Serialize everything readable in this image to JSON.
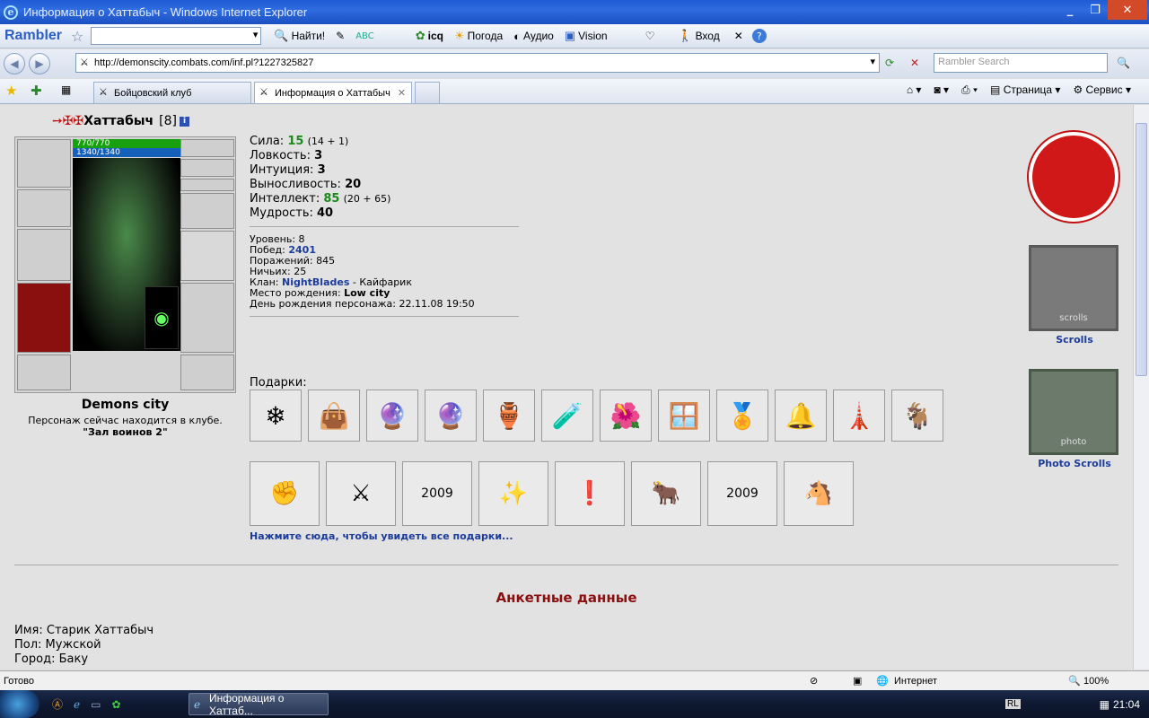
{
  "window": {
    "title": "Информация о Хаттабыч - Windows Internet Explorer",
    "controls": [
      "_",
      "❐",
      "✕"
    ]
  },
  "toolbar": {
    "brand": "Rambler",
    "find_label": "Найти!",
    "icq": "icq",
    "weather": "Погода",
    "audio": "Аудио",
    "vision": "Vision",
    "login": "Вход"
  },
  "address": {
    "url": "http://demonscity.combats.com/inf.pl?1227325827",
    "search_placeholder": "Rambler Search"
  },
  "tabs": [
    {
      "label": "Бойцовский клуб"
    },
    {
      "label": "Информация о Хаттабыч",
      "close": "✕"
    }
  ],
  "cmdbar": {
    "page": "Страница",
    "service": "Сервис"
  },
  "char": {
    "name": "Хаттабыч",
    "level": "[8]",
    "hp": "770/770",
    "mp": "1340/1340",
    "city": "Demons city",
    "location_text": "Персонаж сейчас находится в клубе.",
    "room": "\"Зал воинов 2\""
  },
  "stats": [
    {
      "label": "Сила:",
      "value": "15",
      "extra": "(14 + 1)",
      "green": true
    },
    {
      "label": "Ловкость:",
      "value": "3",
      "extra": "",
      "green": false
    },
    {
      "label": "Интуиция:",
      "value": "3",
      "extra": "",
      "green": false
    },
    {
      "label": "Выносливость:",
      "value": "20",
      "extra": "",
      "green": false
    },
    {
      "label": "Интеллект:",
      "value": "85",
      "extra": "(20 + 65)",
      "green": true
    },
    {
      "label": "Мудрость:",
      "value": "40",
      "extra": "",
      "green": false
    }
  ],
  "info": {
    "level_label": "Уровень:",
    "level": "8",
    "wins_label": "Побед:",
    "wins": "2401",
    "losses_label": "Поражений:",
    "losses": "845",
    "draws_label": "Ничьих:",
    "draws": "25",
    "clan_label": "Клан:",
    "clan": "NightBlades",
    "clan_rank": "- Кайфарик",
    "birthplace_label": "Место рождения:",
    "birthplace": "Low city",
    "birthday_label": "День рождения персонажа:",
    "birthday": "22.11.08 19:50"
  },
  "gifts": {
    "label": "Подарки:",
    "all_link": "Нажмите сюда, чтобы увидеть все подарки...",
    "items": [
      "❄",
      "👜",
      "🔮",
      "🔮",
      "🏺",
      "🧪",
      "🌺",
      "🪟",
      "🏅",
      "🔔",
      "🗼",
      "🐐"
    ],
    "cards": [
      "✊",
      "⚔",
      "2009",
      "✨",
      "❗",
      "🐂",
      "2009",
      "🐴"
    ]
  },
  "banners": {
    "scrolls": "Scrolls",
    "photo_scrolls": "Photo Scrolls",
    "scrolls_text": "scrolls",
    "photo_text": "photo"
  },
  "profile": {
    "section_title": "Анкетные данные",
    "name": "Имя: Старик Хаттабыч",
    "sex": "Пол: Мужской",
    "city": "Город: Баку"
  },
  "status": {
    "text": "Готово",
    "zone": "Интернет",
    "zoom": "100%"
  },
  "taskbar": {
    "task": "Информация о Хаттаб...",
    "lang": "RL",
    "time": "21:04"
  }
}
